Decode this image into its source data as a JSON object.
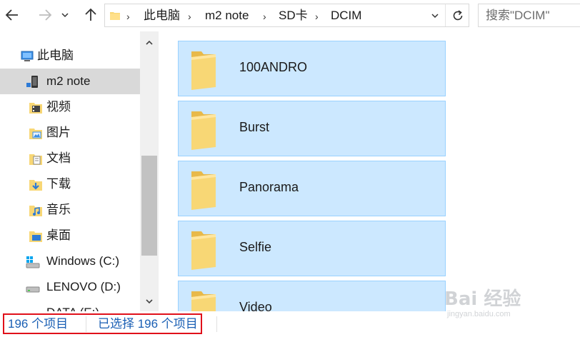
{
  "toolbar": {
    "back_icon": "arrow-left-icon",
    "forward_icon": "arrow-right-icon",
    "recent_icon": "chevron-down-icon",
    "up_icon": "arrow-up-icon"
  },
  "address_bar": {
    "breadcrumbs": [
      "此电脑",
      "m2 note",
      "SD卡",
      "DCIM"
    ],
    "separator": "›",
    "refresh_icon": "refresh-icon",
    "dropdown_icon": "chevron-down-icon"
  },
  "search": {
    "placeholder": "搜索\"DCIM\""
  },
  "sidebar": {
    "items": [
      {
        "label": "此电脑",
        "icon": "computer-icon",
        "selected": false
      },
      {
        "label": "m2 note",
        "icon": "phone-icon",
        "selected": true
      },
      {
        "label": "视频",
        "icon": "video-folder-icon",
        "selected": false
      },
      {
        "label": "图片",
        "icon": "pictures-folder-icon",
        "selected": false
      },
      {
        "label": "文档",
        "icon": "documents-folder-icon",
        "selected": false
      },
      {
        "label": "下载",
        "icon": "downloads-folder-icon",
        "selected": false
      },
      {
        "label": "音乐",
        "icon": "music-folder-icon",
        "selected": false
      },
      {
        "label": "桌面",
        "icon": "desktop-folder-icon",
        "selected": false
      },
      {
        "label": "Windows (C:)",
        "icon": "windows-drive-icon",
        "selected": false
      },
      {
        "label": "LENOVO (D:)",
        "icon": "drive-icon",
        "selected": false
      },
      {
        "label": "DATA (E:)",
        "icon": "drive-icon",
        "selected": false
      }
    ]
  },
  "folders": [
    {
      "name": "100ANDRO"
    },
    {
      "name": "Burst"
    },
    {
      "name": "Panorama"
    },
    {
      "name": "Selfie"
    },
    {
      "name": "Video"
    }
  ],
  "status": {
    "item_count": "196 个项目",
    "selected_count": "已选择 196 个项目"
  },
  "watermark": {
    "text": "Bai 经验",
    "sub": "jingyan.baidu.com"
  },
  "colors": {
    "selection_fill": "#cce8ff",
    "selection_border": "#99d1ff",
    "status_text": "#1a5fb4",
    "highlight_box": "#e0101a",
    "folder_yellow": "#f8d775"
  }
}
